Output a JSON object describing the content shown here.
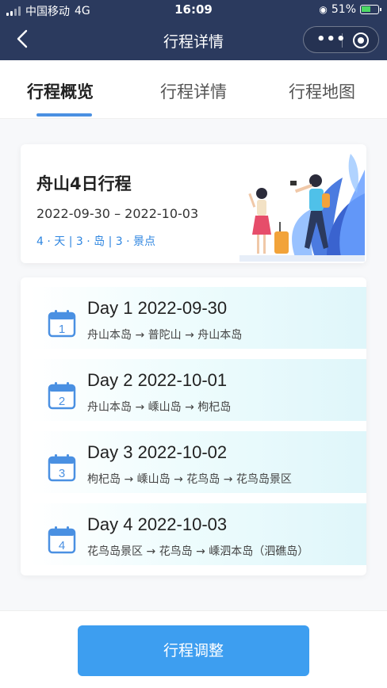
{
  "status_bar": {
    "carrier": "中国移动",
    "network": "4G",
    "time": "16:09",
    "battery": "51%"
  },
  "nav": {
    "title": "行程详情",
    "back_icon": "chevron-left-icon",
    "more_icon": "more-dots-icon",
    "close_icon": "target-icon"
  },
  "tabs": [
    {
      "label": "行程概览",
      "active": true
    },
    {
      "label": "行程详情",
      "active": false
    },
    {
      "label": "行程地图",
      "active": false
    }
  ],
  "summary": {
    "title": "舟山4日行程",
    "dates": "2022-09-30 – 2022-10-03",
    "stats": "4 · 天 | 3 · 岛 | 3 · 景点"
  },
  "days": [
    {
      "num": "1",
      "head": "Day 1 2022-09-30",
      "route": "舟山本岛 → 普陀山 → 舟山本岛"
    },
    {
      "num": "2",
      "head": "Day 2 2022-10-01",
      "route": "舟山本岛 → 嵊山岛 → 枸杞岛"
    },
    {
      "num": "3",
      "head": "Day 3 2022-10-02",
      "route": "枸杞岛 → 嵊山岛 → 花鸟岛 → 花鸟岛景区"
    },
    {
      "num": "4",
      "head": "Day 4 2022-10-03",
      "route": "花鸟岛景区 → 花鸟岛 → 嵊泗本岛（泗礁岛）"
    }
  ],
  "bottom": {
    "button_label": "行程调整"
  },
  "colors": {
    "nav_bg": "#2b3a5e",
    "accent": "#4a90e2",
    "button": "#3d9ef0",
    "stats_text": "#2f86e0"
  }
}
